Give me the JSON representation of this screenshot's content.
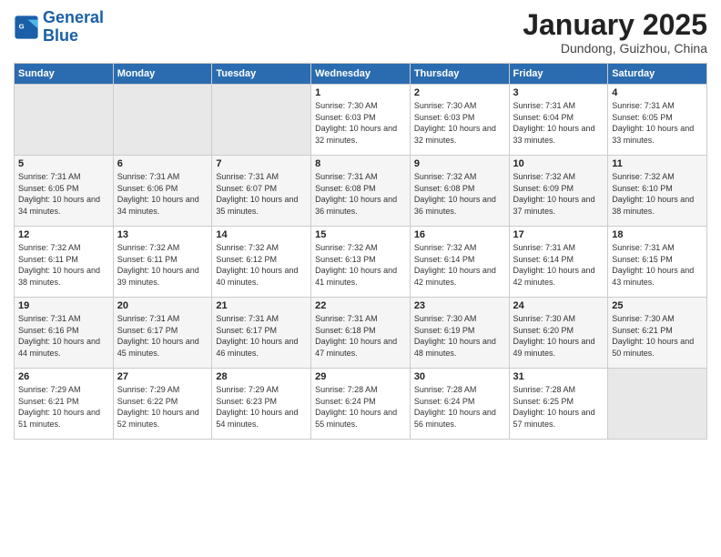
{
  "logo": {
    "line1": "General",
    "line2": "Blue"
  },
  "title": "January 2025",
  "location": "Dundong, Guizhou, China",
  "weekdays": [
    "Sunday",
    "Monday",
    "Tuesday",
    "Wednesday",
    "Thursday",
    "Friday",
    "Saturday"
  ],
  "weeks": [
    [
      {
        "day": "",
        "content": ""
      },
      {
        "day": "",
        "content": ""
      },
      {
        "day": "",
        "content": ""
      },
      {
        "day": "1",
        "content": "Sunrise: 7:30 AM\nSunset: 6:03 PM\nDaylight: 10 hours\nand 32 minutes."
      },
      {
        "day": "2",
        "content": "Sunrise: 7:30 AM\nSunset: 6:03 PM\nDaylight: 10 hours\nand 32 minutes."
      },
      {
        "day": "3",
        "content": "Sunrise: 7:31 AM\nSunset: 6:04 PM\nDaylight: 10 hours\nand 33 minutes."
      },
      {
        "day": "4",
        "content": "Sunrise: 7:31 AM\nSunset: 6:05 PM\nDaylight: 10 hours\nand 33 minutes."
      }
    ],
    [
      {
        "day": "5",
        "content": "Sunrise: 7:31 AM\nSunset: 6:05 PM\nDaylight: 10 hours\nand 34 minutes."
      },
      {
        "day": "6",
        "content": "Sunrise: 7:31 AM\nSunset: 6:06 PM\nDaylight: 10 hours\nand 34 minutes."
      },
      {
        "day": "7",
        "content": "Sunrise: 7:31 AM\nSunset: 6:07 PM\nDaylight: 10 hours\nand 35 minutes."
      },
      {
        "day": "8",
        "content": "Sunrise: 7:31 AM\nSunset: 6:08 PM\nDaylight: 10 hours\nand 36 minutes."
      },
      {
        "day": "9",
        "content": "Sunrise: 7:32 AM\nSunset: 6:08 PM\nDaylight: 10 hours\nand 36 minutes."
      },
      {
        "day": "10",
        "content": "Sunrise: 7:32 AM\nSunset: 6:09 PM\nDaylight: 10 hours\nand 37 minutes."
      },
      {
        "day": "11",
        "content": "Sunrise: 7:32 AM\nSunset: 6:10 PM\nDaylight: 10 hours\nand 38 minutes."
      }
    ],
    [
      {
        "day": "12",
        "content": "Sunrise: 7:32 AM\nSunset: 6:11 PM\nDaylight: 10 hours\nand 38 minutes."
      },
      {
        "day": "13",
        "content": "Sunrise: 7:32 AM\nSunset: 6:11 PM\nDaylight: 10 hours\nand 39 minutes."
      },
      {
        "day": "14",
        "content": "Sunrise: 7:32 AM\nSunset: 6:12 PM\nDaylight: 10 hours\nand 40 minutes."
      },
      {
        "day": "15",
        "content": "Sunrise: 7:32 AM\nSunset: 6:13 PM\nDaylight: 10 hours\nand 41 minutes."
      },
      {
        "day": "16",
        "content": "Sunrise: 7:32 AM\nSunset: 6:14 PM\nDaylight: 10 hours\nand 42 minutes."
      },
      {
        "day": "17",
        "content": "Sunrise: 7:31 AM\nSunset: 6:14 PM\nDaylight: 10 hours\nand 42 minutes."
      },
      {
        "day": "18",
        "content": "Sunrise: 7:31 AM\nSunset: 6:15 PM\nDaylight: 10 hours\nand 43 minutes."
      }
    ],
    [
      {
        "day": "19",
        "content": "Sunrise: 7:31 AM\nSunset: 6:16 PM\nDaylight: 10 hours\nand 44 minutes."
      },
      {
        "day": "20",
        "content": "Sunrise: 7:31 AM\nSunset: 6:17 PM\nDaylight: 10 hours\nand 45 minutes."
      },
      {
        "day": "21",
        "content": "Sunrise: 7:31 AM\nSunset: 6:17 PM\nDaylight: 10 hours\nand 46 minutes."
      },
      {
        "day": "22",
        "content": "Sunrise: 7:31 AM\nSunset: 6:18 PM\nDaylight: 10 hours\nand 47 minutes."
      },
      {
        "day": "23",
        "content": "Sunrise: 7:30 AM\nSunset: 6:19 PM\nDaylight: 10 hours\nand 48 minutes."
      },
      {
        "day": "24",
        "content": "Sunrise: 7:30 AM\nSunset: 6:20 PM\nDaylight: 10 hours\nand 49 minutes."
      },
      {
        "day": "25",
        "content": "Sunrise: 7:30 AM\nSunset: 6:21 PM\nDaylight: 10 hours\nand 50 minutes."
      }
    ],
    [
      {
        "day": "26",
        "content": "Sunrise: 7:29 AM\nSunset: 6:21 PM\nDaylight: 10 hours\nand 51 minutes."
      },
      {
        "day": "27",
        "content": "Sunrise: 7:29 AM\nSunset: 6:22 PM\nDaylight: 10 hours\nand 52 minutes."
      },
      {
        "day": "28",
        "content": "Sunrise: 7:29 AM\nSunset: 6:23 PM\nDaylight: 10 hours\nand 54 minutes."
      },
      {
        "day": "29",
        "content": "Sunrise: 7:28 AM\nSunset: 6:24 PM\nDaylight: 10 hours\nand 55 minutes."
      },
      {
        "day": "30",
        "content": "Sunrise: 7:28 AM\nSunset: 6:24 PM\nDaylight: 10 hours\nand 56 minutes."
      },
      {
        "day": "31",
        "content": "Sunrise: 7:28 AM\nSunset: 6:25 PM\nDaylight: 10 hours\nand 57 minutes."
      },
      {
        "day": "",
        "content": ""
      }
    ]
  ]
}
